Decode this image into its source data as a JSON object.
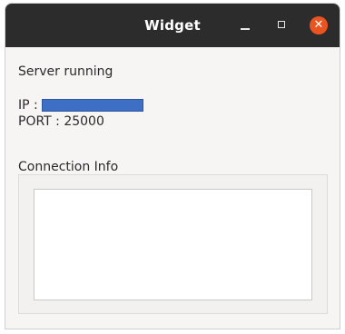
{
  "window": {
    "title": "Widget",
    "controls": {
      "minimize_icon": "minimize-icon",
      "maximize_icon": "maximize-icon",
      "close_icon": "close-icon",
      "close_color": "#e95420"
    }
  },
  "main": {
    "status_label": "Server running",
    "ip_label": "IP :",
    "ip_value_highlight_color": "#3d6fc4",
    "port_label": "PORT : 25000",
    "connection_info_label": "Connection Info",
    "connection_info_text": ""
  }
}
